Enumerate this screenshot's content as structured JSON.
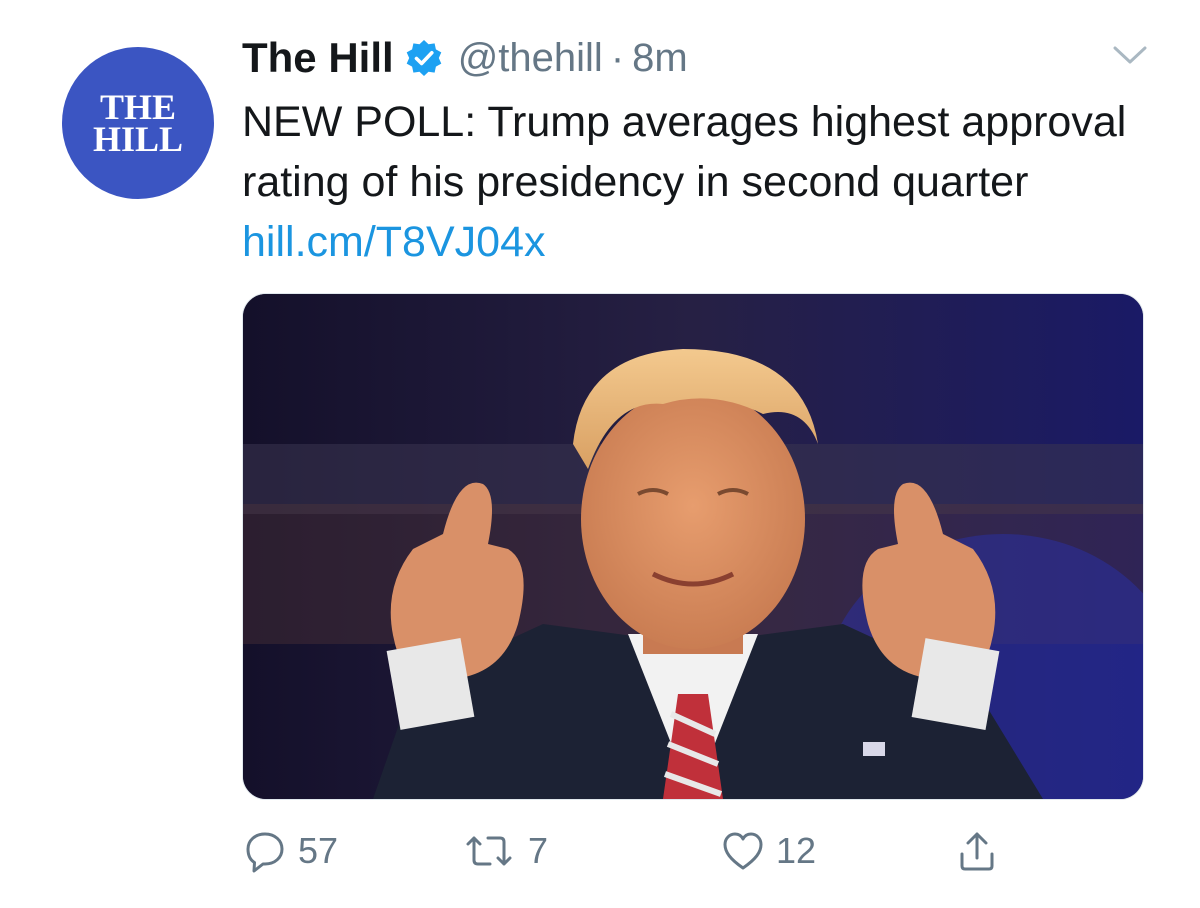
{
  "tweet": {
    "avatar_lines": [
      "THE",
      "HILL"
    ],
    "display_name": "The Hill",
    "handle": "@thehill",
    "separator": "·",
    "timestamp": "8m",
    "text": "NEW POLL: Trump averages highest approval rating of his presidency in second quarter",
    "link": "hill.cm/T8VJ04x",
    "counts": {
      "replies": "57",
      "retweets": "7",
      "likes": "12"
    }
  },
  "icons": {
    "verified": "verified-badge-icon",
    "more": "chevron-down-icon",
    "reply": "reply-icon",
    "retweet": "retweet-icon",
    "like": "heart-icon",
    "share": "share-icon"
  },
  "colors": {
    "brand_avatar": "#3b55c2",
    "verified": "#1da1f2",
    "link": "#1b95e0",
    "muted": "#657786",
    "text": "#14171a"
  }
}
